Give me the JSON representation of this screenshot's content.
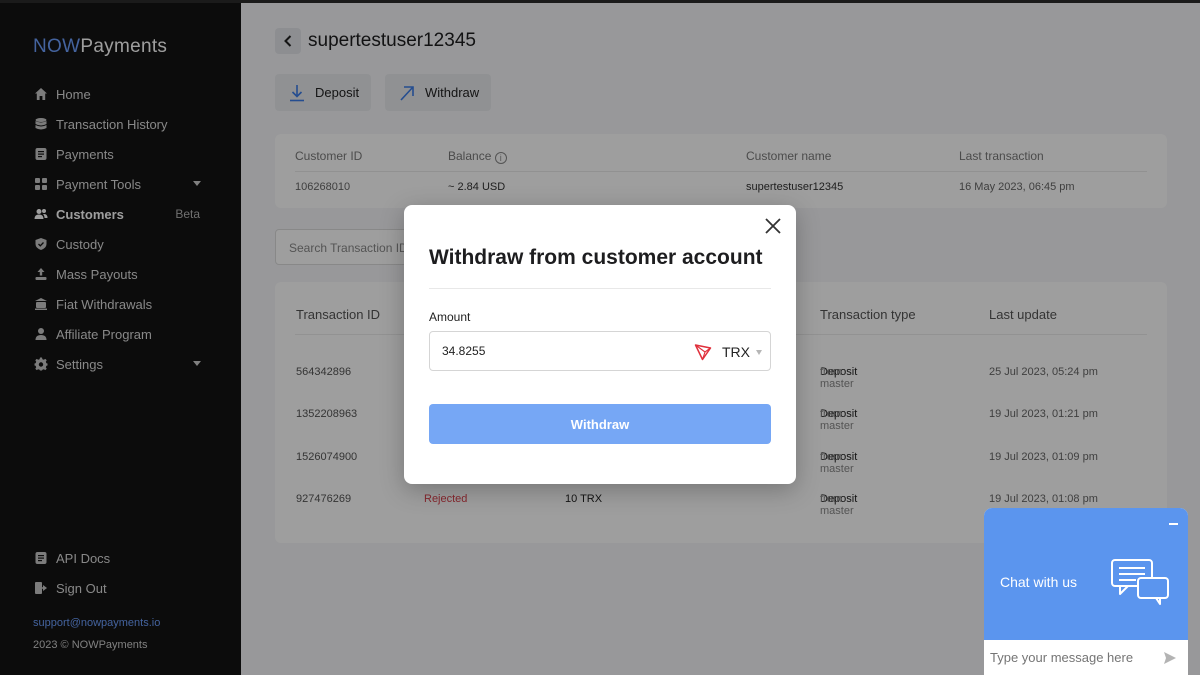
{
  "sidebar": {
    "logo_prefix": "NOW",
    "logo_suffix": "Payments",
    "items": [
      {
        "label": "Home",
        "icon": "home-icon"
      },
      {
        "label": "Transaction History",
        "icon": "database-icon"
      },
      {
        "label": "Payments",
        "icon": "document-icon"
      },
      {
        "label": "Payment Tools",
        "icon": "grid-icon"
      },
      {
        "label": "Customers",
        "icon": "users-icon",
        "badge": "Beta"
      },
      {
        "label": "Custody",
        "icon": "shield-icon"
      },
      {
        "label": "Mass Payouts",
        "icon": "upload-icon"
      },
      {
        "label": "Fiat Withdrawals",
        "icon": "bank-icon"
      },
      {
        "label": "Affiliate Program",
        "icon": "user-icon"
      },
      {
        "label": "Settings",
        "icon": "gear-icon"
      }
    ],
    "bottom_items": [
      {
        "label": "API Docs",
        "icon": "document-icon"
      },
      {
        "label": "Sign Out",
        "icon": "sign-out-icon"
      }
    ],
    "support_email": "support@nowpayments.io",
    "copyright": "2023 © NOWPayments"
  },
  "header": {
    "title": "supertestuser12345",
    "deposit_label": "Deposit",
    "withdraw_label": "Withdraw"
  },
  "customer_info": {
    "headers": [
      "Customer ID",
      "Balance",
      "Customer name",
      "Last transaction"
    ],
    "values": [
      "106268010",
      "~ 2.84 USD",
      "supertestuser12345",
      "16 May 2023, 06:45 pm"
    ]
  },
  "search": {
    "placeholder": "Search Transaction ID"
  },
  "transactions": {
    "headers": [
      "Transaction ID",
      "Transaction type",
      "Last update"
    ],
    "rows": [
      {
        "id": "564342896",
        "status": "",
        "amount": "",
        "type": "Deposit",
        "type_from": "from master",
        "date": "25 Jul 2023, 05:24 pm"
      },
      {
        "id": "1352208963",
        "status": "",
        "amount": "",
        "type": "Deposit",
        "type_from": "from master",
        "date": "19 Jul 2023, 01:21 pm"
      },
      {
        "id": "1526074900",
        "status": "",
        "amount": "",
        "type": "Deposit",
        "type_from": "from master",
        "date": "19 Jul 2023, 01:09 pm"
      },
      {
        "id": "927476269",
        "status": "Rejected",
        "amount": "10 TRX",
        "type": "Deposit",
        "type_from": "from master",
        "date": "19 Jul 2023, 01:08 pm"
      }
    ]
  },
  "modal": {
    "title": "Withdraw from customer account",
    "amount_label": "Amount",
    "amount_value": "34.8255",
    "currency": "TRX",
    "currency_icon": "tron-icon",
    "submit_label": "Withdraw"
  },
  "chat": {
    "title": "Chat with us",
    "placeholder": "Type your message here"
  },
  "colors": {
    "accent": "#5b95ee",
    "button": "#76a7f5",
    "rejected": "#d9414c",
    "sidebar": "#141414"
  }
}
